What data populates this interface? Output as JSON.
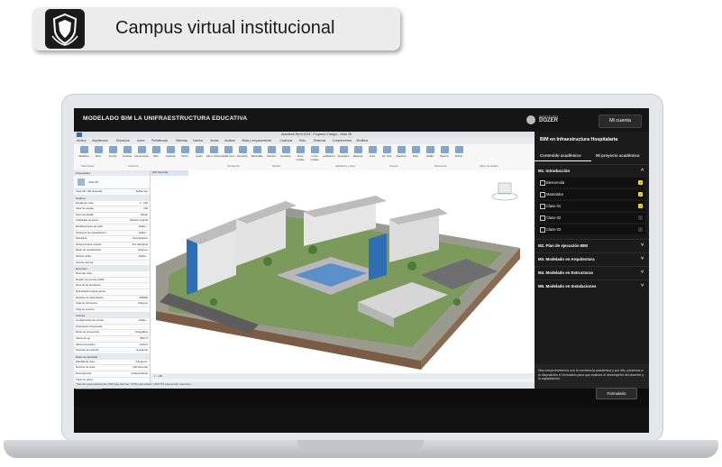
{
  "banner": {
    "title": "Campus virtual institucional",
    "logo_icon": "shield-crest-icon"
  },
  "course": {
    "title": "MODELADO BIM LA UNIFRAESTRUCTURA EDUCATIVA",
    "brand_small": "INSTITUTO",
    "brand_name": "DOZER",
    "account_button": "Mi cuenta"
  },
  "revit": {
    "document_title": "Autodesk Revit 2024 - Proyecto Colegio - Vista 3D",
    "ribbon_tabs": [
      "Archivo",
      "Arquitectura",
      "Estructura",
      "Acero",
      "Prefabricado",
      "Sistemas",
      "Insertar",
      "Anotar",
      "Analizar",
      "Masa y emplazamiento",
      "Colaborar",
      "Vista",
      "Gestionar",
      "Complementos",
      "Modificar"
    ],
    "ribbon_buttons": [
      "Modificar",
      "Muro",
      "Puerta",
      "Ventana",
      "Componente",
      "Pilar",
      "Cubierta",
      "Techo",
      "Suelo",
      "Muro cortina",
      "Rejilla muro",
      "Montante",
      "Barandilla",
      "Rampa",
      "Escalera",
      "Texto modelo",
      "Línea modelo",
      "Habitación",
      "Separador",
      "Etiqueta",
      "Área",
      "Por cara",
      "Abertura",
      "Nivel",
      "Rejilla",
      "Mostrar",
      "Definir"
    ],
    "ribbon_panels": [
      "Seleccionar",
      "Construir",
      "Circulación",
      "Modelo",
      "Habitación y área",
      "Huecos",
      "Referencia",
      "Plano de trabajo"
    ],
    "properties": {
      "header": "Propiedades",
      "view_type": "Vista 3D",
      "view_filter": "Vista 3D: {3D General}",
      "edit_type": "Editar tipo",
      "sections": [
        {
          "title": "Gráficos",
          "rows": [
            [
              "Escala de vista",
              "1 : 100"
            ],
            [
              "Valor de escala",
              "100"
            ],
            [
              "Nivel de detalle",
              "Medio"
            ],
            [
              "Visibilidad de pieza",
              "Mostrar original"
            ],
            [
              "Modificaciones de visib.",
              "Editar..."
            ],
            [
              "Opciones de visualización",
              "Editar..."
            ],
            [
              "Disciplina",
              "Coordinación"
            ],
            [
              "Mostrar líneas ocultas",
              "Por disciplina"
            ],
            [
              "Estilo de visualización",
              "Ninguno"
            ],
            [
              "Mostrar grilla",
              "Editar..."
            ],
            [
              "Camino del sol",
              ""
            ]
          ]
        },
        {
          "title": "Extensión",
          "rows": [
            [
              "Recortar vista",
              ""
            ],
            [
              "Región de recorte visible",
              ""
            ],
            [
              "Recorte de anotación",
              ""
            ],
            [
              "Delimitación lejana activa",
              ""
            ],
            [
              "Desfase de delimitación",
              "304800"
            ],
            [
              "Caja de referencia",
              "Ninguno"
            ],
            [
              "Caja de sección",
              ""
            ]
          ]
        },
        {
          "title": "Cámara",
          "rows": [
            [
              "Configuración de render",
              "Editar..."
            ],
            [
              "Orientación bloqueada",
              ""
            ],
            [
              "Modo de proyección",
              "Ortográfica"
            ],
            [
              "Altura de ojo",
              "5667.2"
            ],
            [
              "Altura de destino",
              "-1244.2"
            ],
            [
              "Posición de cámara",
              "Ajustando"
            ]
          ]
        },
        {
          "title": "Datos de identidad",
          "rows": [
            [
              "Plantilla de vista",
              "<Ninguno>"
            ],
            [
              "Nombre de vista",
              "{3D General}"
            ],
            [
              "Dependencia",
              "Independiente"
            ],
            [
              "Título en plano",
              ""
            ]
          ]
        }
      ],
      "help_link": "Ayuda de propiedades",
      "apply": "Aplicar"
    },
    "view_tab": "{3D General}",
    "view_scale": "1 : 100",
    "status_text": "Haz clic para seleccionar, TAB para alternar, CTRL para añadir y MAYÚS para anular selección."
  },
  "side": {
    "course_name": "BIM en Infraestructura Hospitalaria",
    "tabs": [
      "Contenido académico",
      "Mi proyecto académico"
    ],
    "modules": [
      {
        "label": "M1. Introducción",
        "open": true
      },
      {
        "label": "M2. Plan de ejecución BIM",
        "open": false
      },
      {
        "label": "M3. Modelado en Arquitectura",
        "open": false
      },
      {
        "label": "M4. Modelado en Estructuras",
        "open": false
      },
      {
        "label": "M5. Modelado en Instalaciones",
        "open": false
      }
    ],
    "lessons": [
      {
        "label": "Bienvenida",
        "done": true
      },
      {
        "label": "Materiales",
        "done": true
      },
      {
        "label": "Clase 01",
        "done": true
      },
      {
        "label": "Clase 02",
        "done": false
      },
      {
        "label": "Clase 03",
        "done": false
      }
    ],
    "note": "Nos comprometemos con la excelencia académica y por ello, ponemos a tu disposición el formulario para que evalúes el desempeño del docente y la capacitación.",
    "form_button": "Formulario"
  },
  "colors": {
    "panel_bg": "#1b1b1b",
    "check_yellow": "#e9d649",
    "revit_blue": "#2f6db5"
  }
}
